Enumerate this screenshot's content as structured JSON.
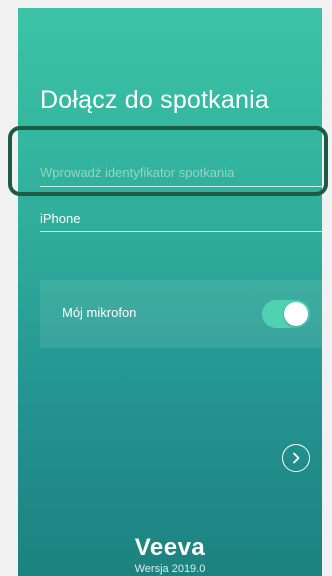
{
  "join": {
    "title": "Dołącz do spotkania",
    "meeting_id_placeholder": "Wprowadź identyfikator spotkania",
    "meeting_id_value": "",
    "display_name_value": "iPhone"
  },
  "microphone": {
    "label": "Mój mikrofon",
    "enabled": true
  },
  "footer": {
    "brand": "Veeva",
    "version": "Wersja 2019.0"
  },
  "colors": {
    "gradient_top": "#3cc3a6",
    "gradient_bottom": "#1c827f",
    "toggle_on": "#4fd1b2",
    "highlight_border": "#1e5b45"
  },
  "icons": {
    "next": "chevron-right-circle-icon"
  }
}
